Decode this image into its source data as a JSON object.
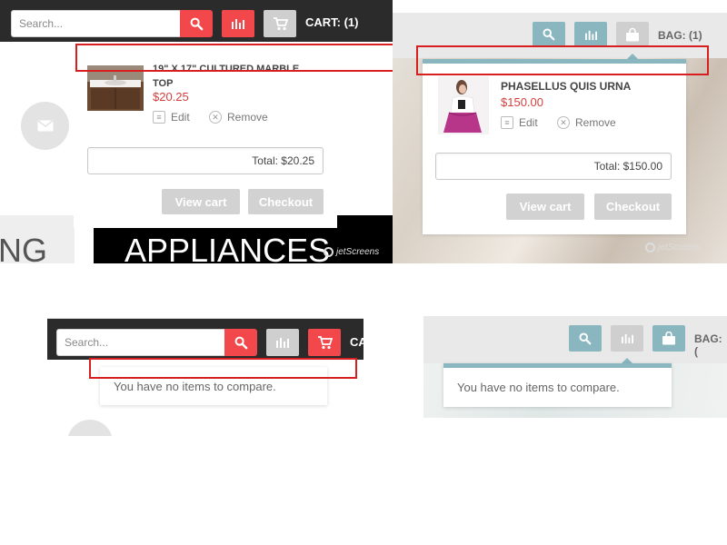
{
  "panel_a": {
    "search": {
      "placeholder": "Search..."
    },
    "cart_label": "CART: (1)",
    "item": {
      "title": "19\" X 17\" CULTURED MARBLE TOP",
      "price": "$20.25"
    },
    "edit_label": "Edit",
    "remove_label": "Remove",
    "total": "Total: $20.25",
    "view_cart": "View cart",
    "checkout": "Checkout",
    "category_left": "NG",
    "category_right": "APPLIANCES",
    "watermark": "jetScreens"
  },
  "panel_b": {
    "bag_label": "BAG: (1)",
    "item": {
      "title": "PHASELLUS QUIS URNA",
      "price": "$150.00"
    },
    "edit_label": "Edit",
    "remove_label": "Remove",
    "total": "Total: $150.00",
    "view_cart": "View cart",
    "checkout": "Checkout",
    "watermark": "jetScreens"
  },
  "panel_c": {
    "search": {
      "placeholder": "Search..."
    },
    "cart_label": "CA",
    "compare_message": "You have no items to compare."
  },
  "panel_d": {
    "bag_label": "BAG: (",
    "compare_message": "You have no items to compare."
  },
  "colors": {
    "red_accent": "#f2484b",
    "teal_accent": "#8ab6c0",
    "price_red": "#d5403f",
    "highlight_outline": "#d81f1f",
    "dark_bar": "#2b2b2b"
  },
  "icons": [
    "search-icon",
    "compare-chart-icon",
    "cart-icon",
    "bag-icon",
    "mail-icon",
    "edit-doc-icon",
    "remove-x-icon"
  ]
}
